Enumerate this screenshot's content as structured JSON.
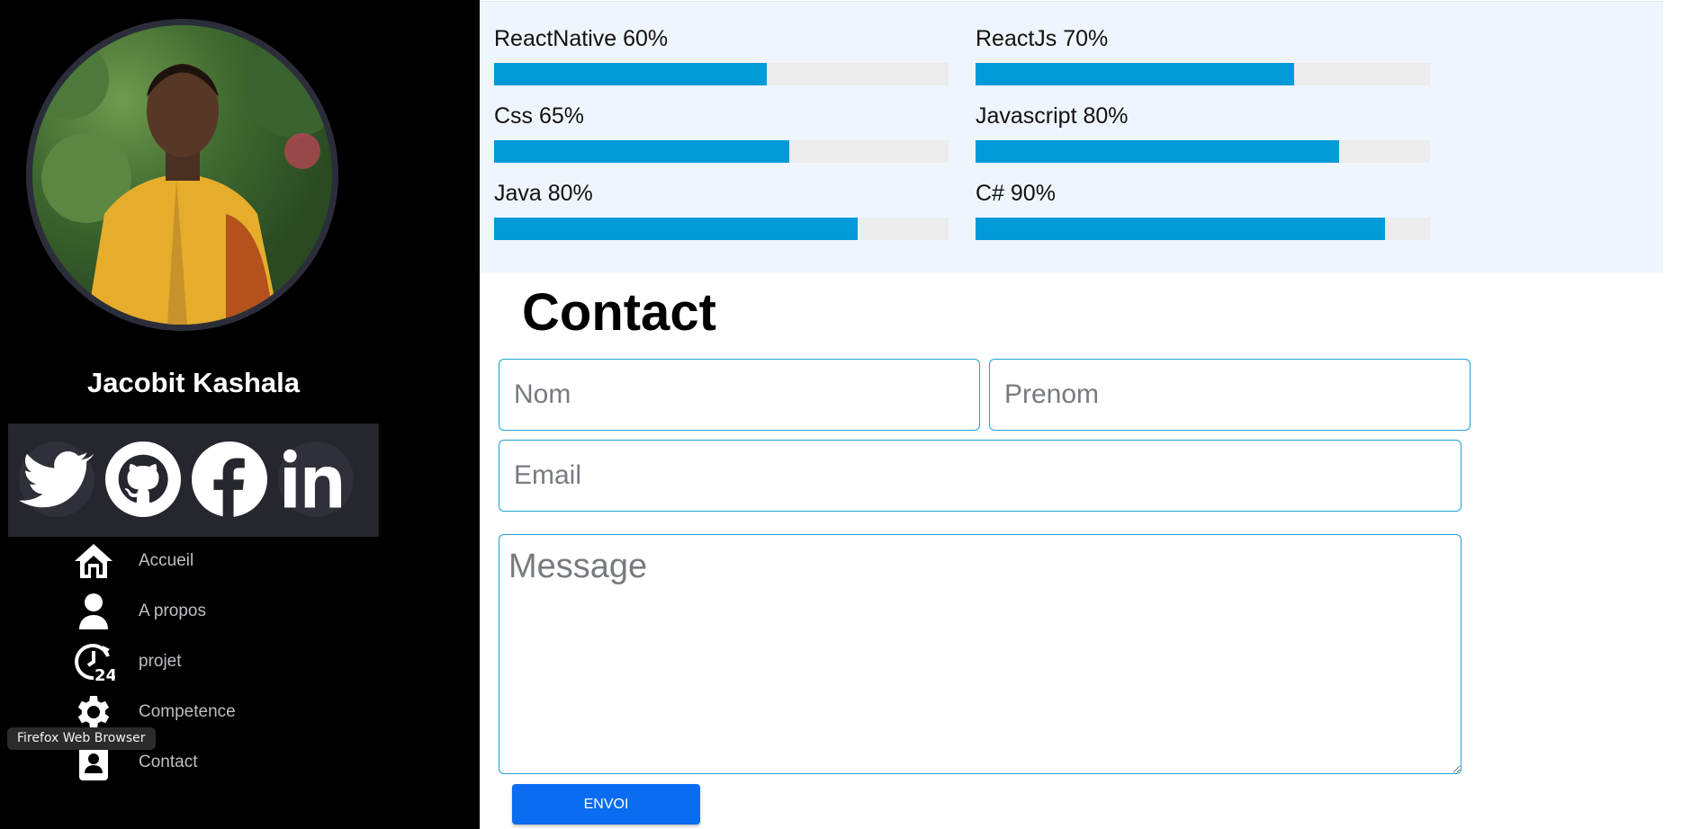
{
  "profile": {
    "name": "Jacobit Kashala",
    "avatar_alt": "profile-photo"
  },
  "social": [
    {
      "name": "twitter-icon"
    },
    {
      "name": "github-icon"
    },
    {
      "name": "facebook-icon"
    },
    {
      "name": "linkedin-icon"
    }
  ],
  "nav": {
    "items": [
      {
        "label": "Accueil",
        "icon": "home-icon"
      },
      {
        "label": "A propos",
        "icon": "user-icon"
      },
      {
        "label": "projet",
        "icon": "clock-24-icon"
      },
      {
        "label": "Competence",
        "icon": "gear-icon"
      },
      {
        "label": "Contact",
        "icon": "contact-card-icon"
      }
    ]
  },
  "tooltip": {
    "text": "Firefox Web Browser"
  },
  "skills": [
    {
      "label": "ReactNative 60%",
      "percent": 60
    },
    {
      "label": "ReactJs 70%",
      "percent": 70
    },
    {
      "label": "Css 65%",
      "percent": 65
    },
    {
      "label": "Javascript 80%",
      "percent": 80
    },
    {
      "label": "Java 80%",
      "percent": 80
    },
    {
      "label": "C# 90%",
      "percent": 90
    }
  ],
  "contact": {
    "title": "Contact",
    "nom_placeholder": "Nom",
    "prenom_placeholder": "Prenom",
    "email_placeholder": "Email",
    "message_placeholder": "Message",
    "submit_label": "ENVOI"
  },
  "colors": {
    "sidebar_bg": "#000000",
    "social_bar_bg": "#25262e",
    "skill_bar": "#009ad8",
    "skill_track": "#ececec",
    "skills_bg": "#eff5fc",
    "button": "#0a6cf0",
    "input_border": "#1ba4d2"
  }
}
